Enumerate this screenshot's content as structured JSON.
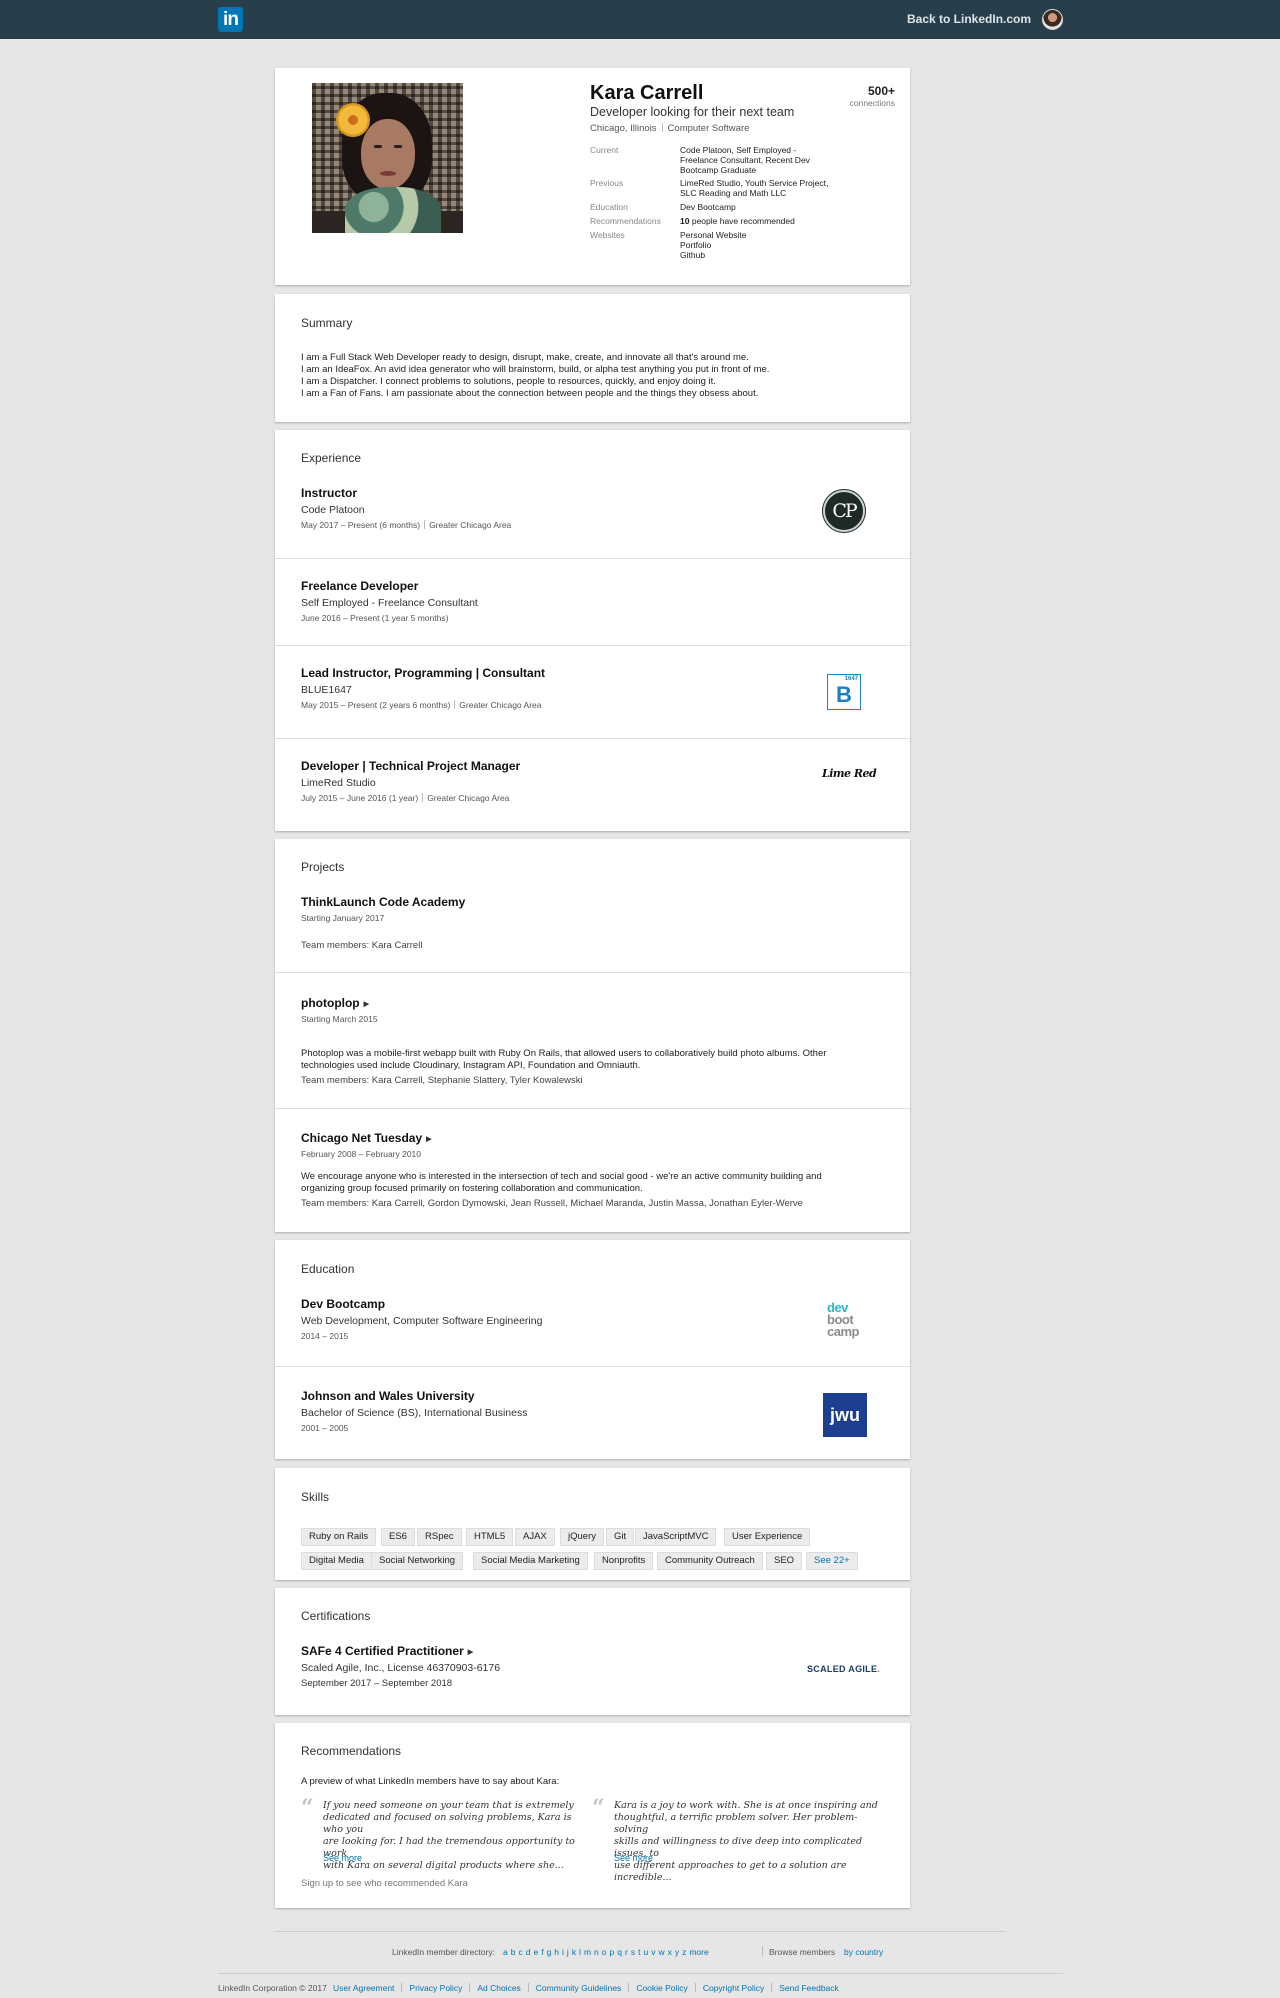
{
  "topbar": {
    "back_link": "Back to LinkedIn.com",
    "logo_text": "in",
    "logo_icon": "linkedin-logo-icon",
    "brand_color": "#0077b5"
  },
  "profile": {
    "name": "Kara Carrell",
    "headline": "Developer looking for their next team",
    "location": "Chicago, Illinois",
    "industry": "Computer Software",
    "connections_count": "500+",
    "connections_label": "connections",
    "current_label": "Current",
    "current_l1": "Code Platoon, Self Employed -",
    "current_l2": "Freelance Consultant, Recent Dev",
    "current_l3": "Bootcamp Graduate",
    "previous_label": "Previous",
    "previous_l1": "LimeRed Studio, Youth Service Project,",
    "previous_l2": "SLC Reading and Math LLC",
    "education_label": "Education",
    "education": "Dev Bootcamp",
    "recommendations_label": "Recommendations",
    "recommendations_count": "10",
    "recommendations_text": "people have recommended",
    "websites_label": "Websites",
    "website_1": "Personal Website",
    "website_2": "Portfolio",
    "website_3": "Github"
  },
  "summary": {
    "title": "Summary",
    "l1": "I am a Full Stack Web Developer ready to design, disrupt, make, create, and innovate all that's around me.",
    "l2": "I am an IdeaFox. An avid idea generator who will brainstorm, build, or alpha test anything you put in front of me.",
    "l3": "I am a Dispatcher. I connect problems to solutions, people to resources, quickly, and enjoy doing it.",
    "l4": "I am a Fan of Fans. I am passionate about the connection between people and the things they obsess about."
  },
  "experience": {
    "title": "Experience",
    "items": [
      {
        "title": "Instructor",
        "company": "Code Platoon",
        "dates": "May 2017 – Present (6 months)",
        "location": "Greater Chicago Area",
        "logo": "CP"
      },
      {
        "title": "Freelance Developer",
        "company": "Self Employed - Freelance Consultant",
        "dates": "June 2016 – Present (1 year 5 months)",
        "location": ""
      },
      {
        "title": "Lead Instructor, Programming | Consultant",
        "company": "BLUE1647",
        "dates": "May 2015 – Present (2 years 6 months)",
        "location": "Greater Chicago Area",
        "logo": "B",
        "logo_small": "1647"
      },
      {
        "title": "Developer | Technical Project Manager",
        "company": "LimeRed Studio",
        "dates": "July 2015 – June 2016 (1 year)",
        "location": "Greater Chicago Area",
        "logo": "Lime Red"
      }
    ]
  },
  "projects": {
    "title": "Projects",
    "team_label": "Team members:",
    "items": [
      {
        "title": "ThinkLaunch Code Academy",
        "dates": "Starting January 2017",
        "members": [
          "Kara Carrell"
        ]
      },
      {
        "title": "photoplop",
        "dates": "Starting March 2015",
        "desc_l1": "Photoplop was a mobile-first webapp built with Ruby On Rails, that allowed users to collaboratively build photo albums. Other",
        "desc_l2": "technologies used include Cloudinary, Instagram API, Foundation and Omniauth.",
        "members": [
          "Kara Carrell,",
          "Stephanie Slattery,",
          "Tyler Kowalewski"
        ]
      },
      {
        "title": "Chicago Net Tuesday",
        "dates": "February 2008 – February 2010",
        "desc_l1": "We encourage anyone who is interested in the intersection of tech and social good - we're an active community building and",
        "desc_l2": "organizing group focused primarily on fostering collaboration and communication.",
        "members": [
          "Kara Carrell,",
          "Gordon Dymowski,",
          "Jean Russell,",
          "Michael Maranda,",
          "Justin Massa,",
          "Jonathan Eyler-Werve"
        ]
      }
    ]
  },
  "education": {
    "title": "Education",
    "items": [
      {
        "school": "Dev Bootcamp",
        "degree": "Web Development, Computer Software Engineering",
        "years": "2014 – 2015",
        "logo_l1": "dev",
        "logo_l2": "boot",
        "logo_l3": "camp"
      },
      {
        "school": "Johnson and Wales University",
        "degree": "Bachelor of Science (BS), International Business",
        "years": "2001 – 2005",
        "logo": "jwu"
      }
    ]
  },
  "skills": {
    "title": "Skills",
    "items": [
      "Ruby on Rails",
      "ES6",
      "RSpec",
      "HTML5",
      "AJAX",
      "jQuery",
      "Git",
      "JavaScriptMVC",
      "User Experience",
      "Digital Media",
      "Social Networking",
      "Social Media Marketing",
      "Nonprofits",
      "Community Outreach",
      "SEO"
    ],
    "see_more": "See 22+"
  },
  "certifications": {
    "title": "Certifications",
    "name": "SAFe 4 Certified Practitioner",
    "issuer": "Scaled Agile, Inc., License 46370903-6176",
    "dates": "September 2017 – September 2018",
    "logo": "SCALED AGILE"
  },
  "recommendations": {
    "title": "Recommendations",
    "intro": "A preview of what LinkedIn members have to say about Kara:",
    "quote_mark": "“",
    "rec1_l1": "If you need someone on your team that is extremely",
    "rec1_l2": "dedicated and focused on solving problems, Kara is who you",
    "rec1_l3": "are looking for. I had the tremendous opportunity to work",
    "rec1_l4": "with Kara on several digital products where she...",
    "rec2_l1": "Kara is a joy to work with. She is at once inspiring and",
    "rec2_l2": "thoughtful, a terrific problem solver. Her problem-solving",
    "rec2_l3": "skills and willingness to dive deep into complicated issues, to",
    "rec2_l4": "use different approaches to get to a solution are incredible...",
    "see_more": "See more",
    "signup": "Sign up to see who recommended Kara"
  },
  "footer": {
    "directory_label": "LinkedIn member directory:",
    "letters": [
      "a",
      "b",
      "c",
      "d",
      "e",
      "f",
      "g",
      "h",
      "i",
      "j",
      "k",
      "l",
      "m",
      "n",
      "o",
      "p",
      "q",
      "r",
      "s",
      "t",
      "u",
      "v",
      "w",
      "x",
      "y",
      "z",
      "more"
    ],
    "browse_label": "Browse members",
    "browse_link": "by country",
    "copyright": "LinkedIn Corporation © 2017",
    "links": [
      "User Agreement",
      "Privacy Policy",
      "Ad Choices",
      "Community Guidelines",
      "Cookie Policy",
      "Copyright Policy",
      "Send Feedback"
    ]
  }
}
